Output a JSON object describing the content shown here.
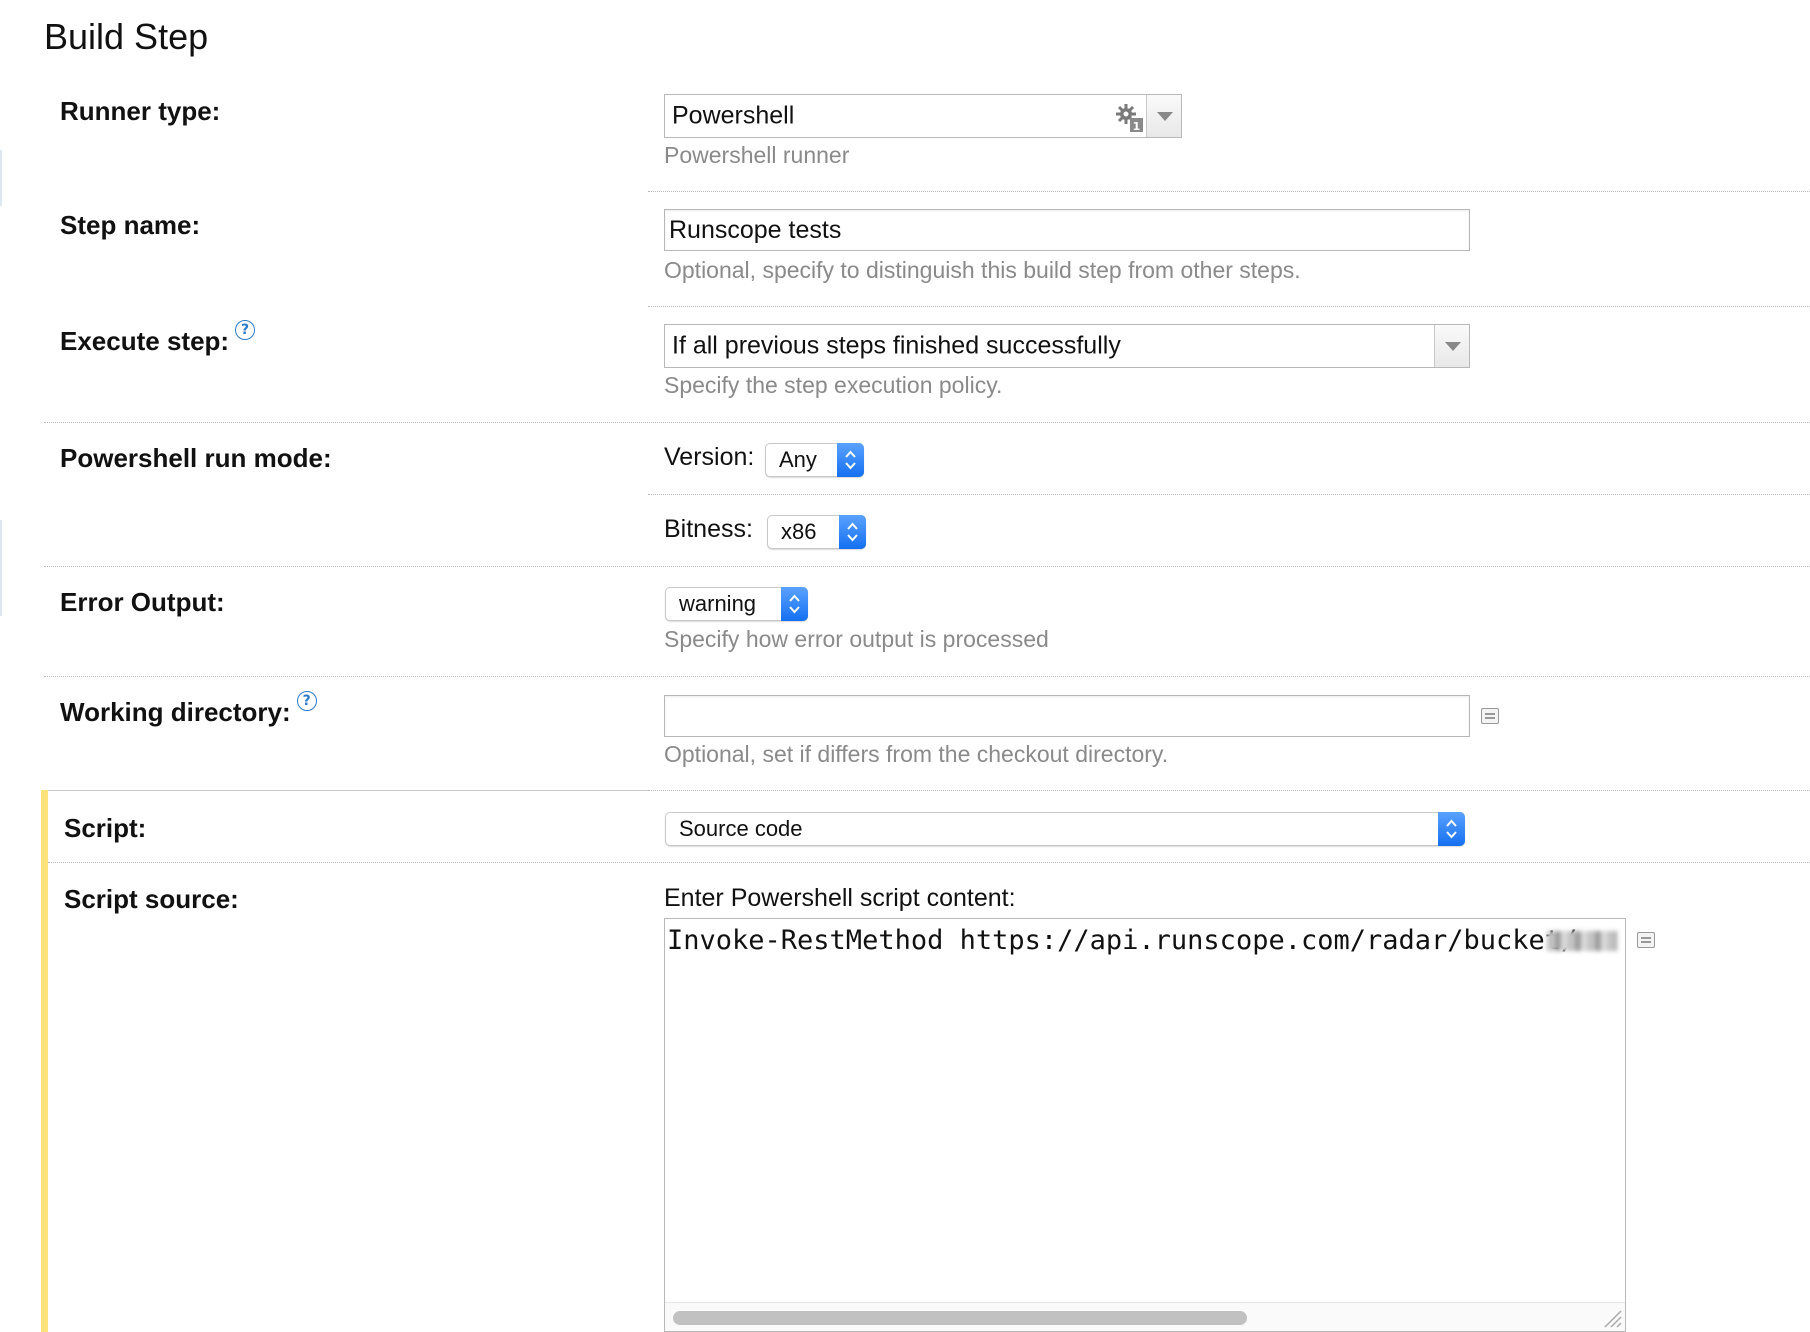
{
  "page": {
    "title": "Build Step"
  },
  "runner_type": {
    "label": "Runner type:",
    "value": "Powershell",
    "hint": "Powershell runner",
    "icon": "runner-gear-icon"
  },
  "step_name": {
    "label": "Step name:",
    "value": "Runscope tests",
    "hint": "Optional, specify to distinguish this build step from other steps."
  },
  "execute_step": {
    "label": "Execute step:",
    "help": "?",
    "value": "If all previous steps finished successfully",
    "hint": "Specify the step execution policy."
  },
  "run_mode": {
    "label": "Powershell run mode:",
    "version_label": "Version:",
    "version_value": "Any",
    "bitness_label": "Bitness:",
    "bitness_value": "x86"
  },
  "error_output": {
    "label": "Error Output:",
    "value": "warning",
    "hint": "Specify how error output is processed"
  },
  "working_directory": {
    "label": "Working directory:",
    "help": "?",
    "value": "",
    "hint": "Optional, set if differs from the checkout directory."
  },
  "script": {
    "label": "Script:",
    "value": "Source code"
  },
  "script_source": {
    "label": "Script source:",
    "prompt": "Enter Powershell script content:",
    "code": "Invoke-RestMethod https://api.runscope.com/radar/bucket/"
  },
  "colors": {
    "accent_blue": "#1470f0",
    "help_blue": "#2d7ccb",
    "highlight_bar": "#fbe27a",
    "hint_gray": "#8a8a8a"
  }
}
